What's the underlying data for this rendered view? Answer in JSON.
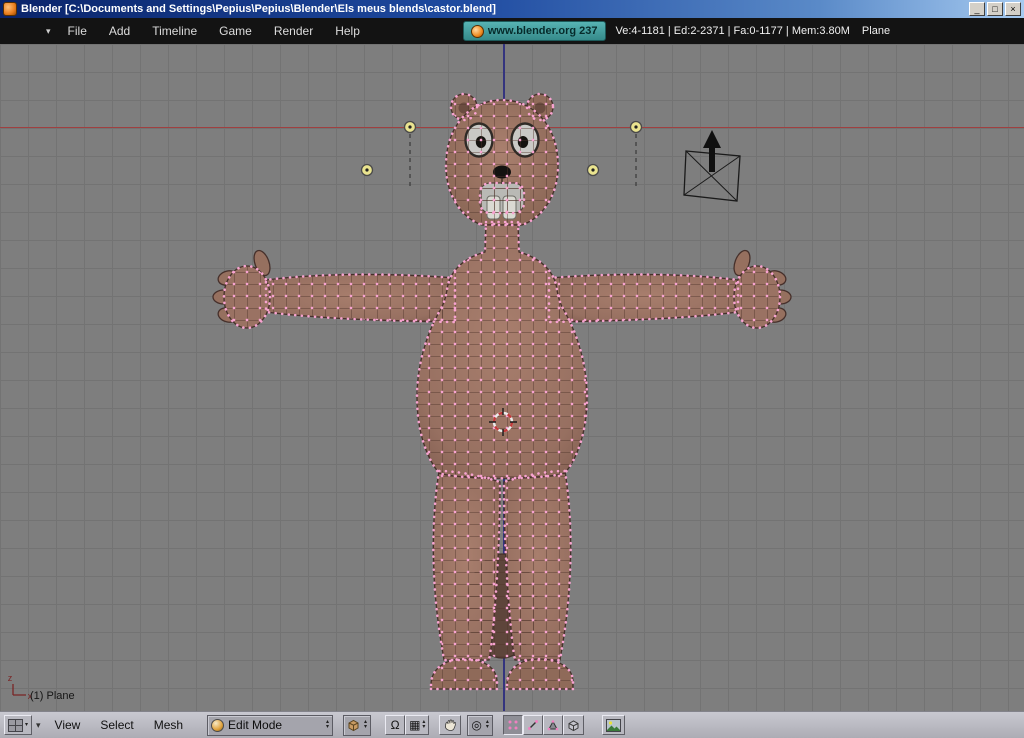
{
  "window": {
    "title": "Blender [C:\\Documents and Settings\\Pepius\\Pepius\\Blender\\Els meus blends\\castor.blend]",
    "minimize": "_",
    "maximize": "□",
    "close": "×"
  },
  "top_header": {
    "menus": [
      "File",
      "Add",
      "Timeline",
      "Game",
      "Render",
      "Help"
    ],
    "badge": "www.blender.org 237",
    "stats": "Ve:4-1181 | Ed:2-2371 | Fa:0-1177 | Mem:3.80M",
    "active_object": "Plane"
  },
  "viewport": {
    "object_info": "(1) Plane",
    "axis": {
      "z": "z",
      "x": "x"
    }
  },
  "bottom_header": {
    "menus": [
      "View",
      "Select",
      "Mesh"
    ],
    "mode": "Edit Mode"
  },
  "icons": {
    "dropdown": "▾",
    "up": "▴",
    "down": "▾",
    "omega": "Ω",
    "falloff": "▦",
    "pivot": "◎"
  },
  "colors": {
    "titlebar_blue": "#0a246a",
    "badge_teal": "#3f9f9f",
    "viewport_gray": "#7e7e7e",
    "body_brown": "#9c7164",
    "vertex_pink": "#f7a3d0",
    "axis_x_red": "#a04040",
    "axis_z_blue": "#34347e",
    "panel_gray": "#b4b4bc"
  }
}
